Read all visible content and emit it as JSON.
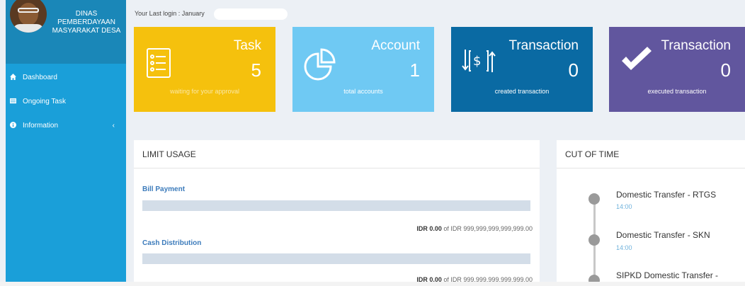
{
  "sidebar": {
    "org_name": "DINAS PEMBERDAYAAN MASYARAKAT DESA",
    "items": [
      {
        "label": "Dashboard",
        "icon": "home-icon"
      },
      {
        "label": "Ongoing Task",
        "icon": "list-icon"
      },
      {
        "label": "Information",
        "icon": "info-icon"
      }
    ]
  },
  "header": {
    "last_login": "Your Last login : January"
  },
  "tiles": [
    {
      "title": "Task",
      "count": "5",
      "subtitle": "waiting for your approval",
      "icon": "checklist-icon",
      "color": "#f5c10d"
    },
    {
      "title": "Account",
      "count": "1",
      "subtitle": "total accounts",
      "icon": "pie-chart-icon",
      "color": "#6fc9f3"
    },
    {
      "title": "Transaction",
      "count": "0",
      "subtitle": "created transaction",
      "icon": "dollar-transfer-icon",
      "color": "#0a6aa3"
    },
    {
      "title": "Transaction",
      "count": "0",
      "subtitle": "executed transaction",
      "icon": "checkmark-icon",
      "color": "#61569e"
    }
  ],
  "limit_usage": {
    "heading": "LIMIT USAGE",
    "items": [
      {
        "label": "Bill Payment",
        "used": "IDR 0.00",
        "of_text": "of IDR 999,999,999,999,999.00"
      },
      {
        "label": "Cash Distribution",
        "used": "IDR 0.00",
        "of_text": "of IDR 999,999,999,999,999.00"
      }
    ]
  },
  "cut_of_time": {
    "heading": "CUT OF TIME",
    "items": [
      {
        "title": "Domestic Transfer - RTGS",
        "time": "14:00"
      },
      {
        "title": "Domestic Transfer - SKN",
        "time": "14:00"
      },
      {
        "title": "SIPKD Domestic Transfer -",
        "time": ""
      }
    ]
  }
}
